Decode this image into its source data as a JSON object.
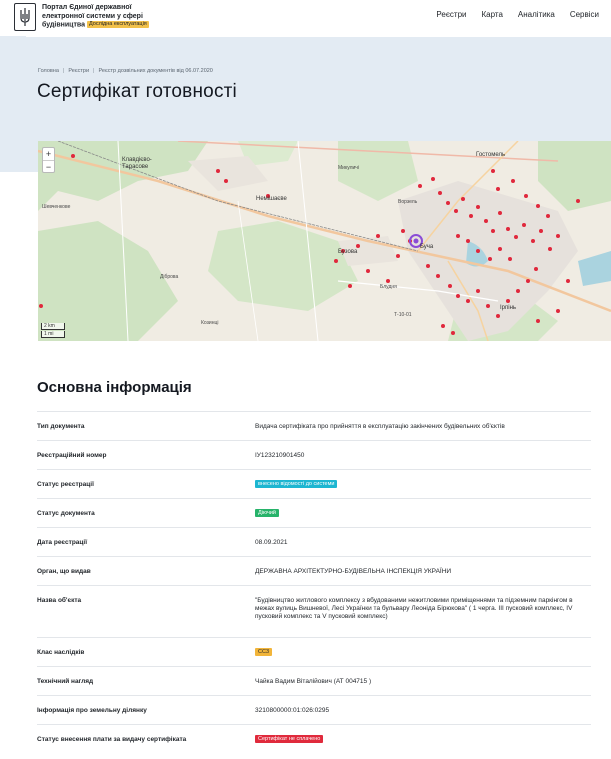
{
  "header": {
    "brand_line1": "Портал Єдиної державної",
    "brand_line2": "електронної системи у сфері",
    "brand_line3": "будівництва",
    "beta": "Дослідна експлуатація",
    "nav": [
      "Реєстри",
      "Карта",
      "Аналітика",
      "Сервіси"
    ]
  },
  "breadcrumb": [
    "Головна",
    "Реєстри",
    "Реєстр дозвільних документів від 06.07.2020"
  ],
  "page_title": "Сертифікат готовності",
  "map": {
    "zoom_in": "+",
    "zoom_out": "−",
    "scale_km": "2 km",
    "scale_mi": "1 mi",
    "labels": {
      "klavdievo": "Клавдієво-",
      "tarasove": "Тарасове",
      "nemishaieve": "Немішаєве",
      "hostomel": "Гостомель",
      "buzova": "Бузова",
      "bucha": "Буча",
      "irpin": "Ірпінь",
      "mykulychi": "Микуличі",
      "dibrova": "Діброва",
      "kozyntsi": "Козинці",
      "shevchenkove": "Шевченкове",
      "bludnia": "Блудня",
      "vorzel": "Ворзель",
      "roadcode": "Т-10-01"
    }
  },
  "section_title": "Основна інформація",
  "rows": [
    {
      "label": "Тип документа",
      "value": "Видача сертифіката про прийняття в експлуатацію закінчених будівельних об'єктів"
    },
    {
      "label": "Реєстраційний номер",
      "value": "ІУ123210901450"
    },
    {
      "label": "Статус реєстрації",
      "badge": "внесено відомості до системи",
      "color": "#1db6d1"
    },
    {
      "label": "Статус документа",
      "badge": "Діючий",
      "color": "#27b36a"
    },
    {
      "label": "Дата реєстрації",
      "value": "08.09.2021"
    },
    {
      "label": "Орган, що видав",
      "value": "ДЕРЖАВНА АРХІТЕКТУРНО-БУДІВЕЛЬНА ІНСПЕКЦІЯ УКРАЇНИ"
    },
    {
      "label": "Назва об'єкта",
      "value": "\"Будівництво житлового комплексу з вбудованими нежитловими приміщеннями та підземним паркінгом в межах вулиць Вишневої, Лесі Українки та бульвару Леоніда Бірюкова\" ( 1 черга. ІІІ пусковий комплекс, IV пусковий комплекс та V пусковий комплекс)"
    },
    {
      "label": "Клас наслідків",
      "badge": "СС3",
      "color": "#f2b53a"
    },
    {
      "label": "Технічний нагляд",
      "value": "Чайка Вадим Віталійович (АТ 004715 )"
    },
    {
      "label": "Інформація про земельну ділянку",
      "value": "3210800000:01:026:0295"
    },
    {
      "label": "Статус внесення плати за видачу сертифіката",
      "badge": "Сертифікат не сплачено",
      "color": "#e02a3c"
    }
  ]
}
